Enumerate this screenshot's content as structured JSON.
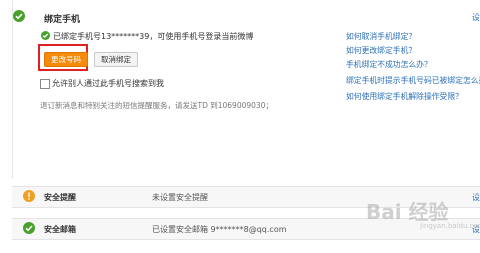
{
  "section_bind": {
    "title": "绑定手机",
    "status_text": "已绑定手机号13*******39，可使用手机号登录当前微博",
    "change_btn": "更改号码",
    "unbind_btn": "取消绑定",
    "allow_search": "允许别人通过此手机号搜索到我",
    "unsubscribe_hint": "退订新消息和特别关注的短信提醒服务，请发送TD 到1069009030；",
    "corner_link": "设",
    "help_links": [
      "如何取消手机绑定？",
      "如何更改绑定手机？",
      "手机绑定不成功怎么办？",
      "绑定手机时提示手机号码已被绑定怎么办",
      "如何使用绑定手机解除操作受限？"
    ]
  },
  "row_alert": {
    "title": "安全提醒",
    "status": "未设置安全提醒",
    "corner_link": "设"
  },
  "row_email": {
    "title": "安全邮箱",
    "status": "已设置安全邮箱 9*******8@qq.com",
    "corner_link": "设"
  },
  "watermark": {
    "text": "Bai 经验",
    "sub": "jingyan.baidu.com"
  },
  "colors": {
    "check_green": "#4aa02c",
    "warn_orange": "#f0a020",
    "link_blue": "#2c6fb8",
    "primary_orange": "#f58a0b",
    "highlight_red": "#e02020"
  }
}
